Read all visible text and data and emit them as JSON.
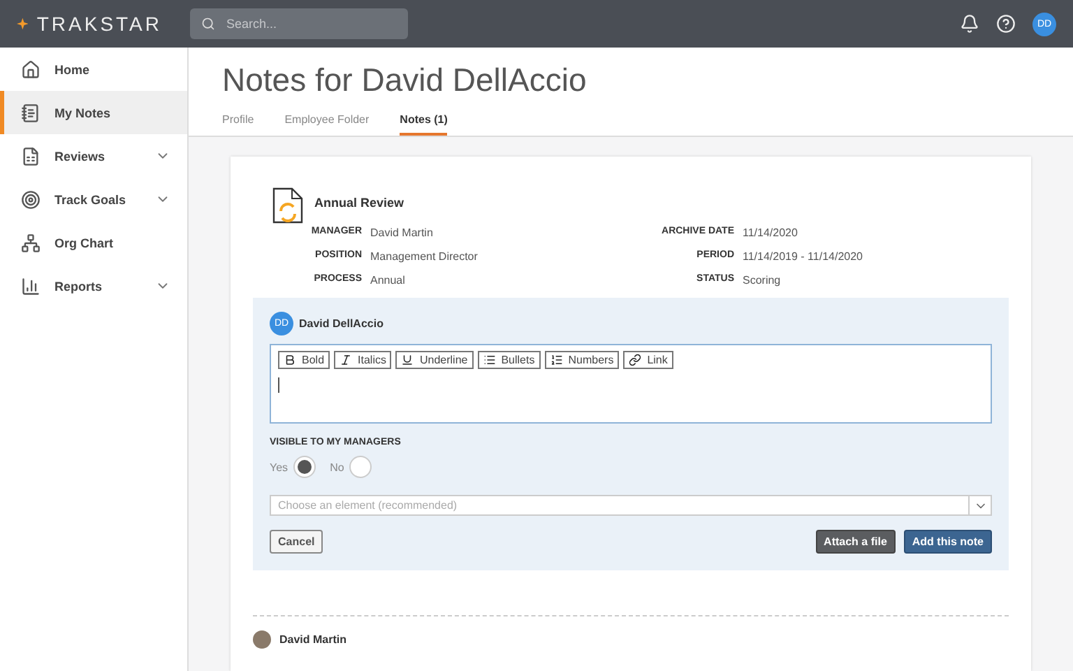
{
  "topbar": {
    "logo": "TRAKSTAR",
    "search": {
      "placeholder": "Search..."
    },
    "avatar": "DD"
  },
  "sidebar": {
    "items": [
      {
        "label": "Home",
        "selected": false,
        "expandable": false
      },
      {
        "label": "My Notes",
        "selected": true,
        "expandable": false
      },
      {
        "label": "Reviews",
        "selected": false,
        "expandable": true
      },
      {
        "label": "Track Goals",
        "selected": false,
        "expandable": true
      },
      {
        "label": "Org Chart",
        "selected": false,
        "expandable": false
      },
      {
        "label": "Reports",
        "selected": false,
        "expandable": true
      }
    ]
  },
  "page": {
    "title": "Notes for David DellAccio",
    "tabs": [
      {
        "label": "Profile",
        "selected": false
      },
      {
        "label": "Employee Folder",
        "selected": false
      },
      {
        "label": "Notes (1)",
        "selected": true
      }
    ]
  },
  "review": {
    "title": "Annual Review",
    "left": [
      {
        "label": "MANAGER",
        "value": "David Martin"
      },
      {
        "label": "POSITION",
        "value": "Management Director"
      },
      {
        "label": "PROCESS",
        "value": "Annual"
      }
    ],
    "right": [
      {
        "label": "ARCHIVE DATE",
        "value": "11/14/2020"
      },
      {
        "label": "PERIOD",
        "value": "11/14/2019 - 11/14/2020"
      },
      {
        "label": "STATUS",
        "value": "Scoring"
      }
    ]
  },
  "note_form": {
    "author": {
      "initials": "DD",
      "name": "David DellAccio"
    },
    "toolbar": [
      {
        "label": "Bold"
      },
      {
        "label": "Italics"
      },
      {
        "label": "Underline"
      },
      {
        "label": "Bullets"
      },
      {
        "label": "Numbers"
      },
      {
        "label": "Link"
      }
    ],
    "visibility": {
      "label": "VISIBLE TO MY MANAGERS",
      "options": [
        {
          "label": "Yes",
          "selected": true
        },
        {
          "label": "No",
          "selected": false
        }
      ]
    },
    "element_select": {
      "placeholder": "Choose an element (recommended)"
    },
    "buttons": [
      {
        "label": "Cancel",
        "kind": "outline"
      },
      {
        "label": "Attach a file",
        "kind": "dark"
      },
      {
        "label": "Add this note",
        "kind": "primary"
      }
    ]
  },
  "notes": [
    {
      "author": "David Martin"
    }
  ]
}
